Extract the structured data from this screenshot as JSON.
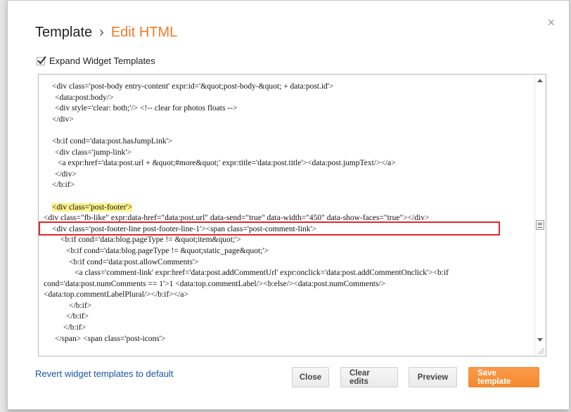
{
  "dialog": {
    "breadcrumb": {
      "parent": "Template",
      "separator": "›",
      "current": "Edit HTML"
    },
    "close_glyph": "×",
    "expand_widget_templates": {
      "label": "Expand Widget Templates",
      "checked": true
    },
    "code_lines": [
      "<div class='post-body entry-content' expr:id='&quot;post-body-&quot; + data:post.id'>",
      "  <data:post.body/>",
      "  <div style='clear: both;'/> <!-- clear for photos floats -->",
      "</div>",
      "",
      "<b:if cond='data:post.hasJumpLink'>",
      "  <div class='jump-link'>",
      "    <a expr:href='data:post.url + &quot;#more&quot;' expr:title='data:post.title'><data:post.jumpText/></a>",
      "  </div>",
      "</b:if>",
      "",
      "<div class='post-footer'>",
      "<div class=\"fb-like\" expr:data-href=\"data:post.url\" data-send=\"true\" data-width=\"450\" data-show-faces=\"true\"></div>",
      "  <div class='post-footer-line post-footer-line-1'><span class='post-comment-link'>",
      "    <b:if cond='data:blog.pageType != &quot;item&quot;'>",
      "      <b:if cond='data:blog.pageType != &quot;static_page&quot;'>",
      "        <b:if cond='data:post.allowComments'>",
      "          <a class='comment-link' expr:href='data:post.addCommentUrl' expr:onclick='data:post.addCommentOnclick'><b:if",
      "cond='data:post.numComments == 1'>1 <data:top.commentLabel/><b:else/><data:post.numComments/>",
      "<data:top.commentLabelPlural/></b:if></a>",
      "        </b:if>",
      "      </b:if>",
      "    </b:if>",
      "  </span> <span class='post-icons'>"
    ],
    "footer": {
      "revert_link": "Revert widget templates to default",
      "buttons": {
        "close": "Close",
        "clear_edits": "Clear edits",
        "preview": "Preview",
        "save_template": "Save template"
      }
    },
    "colors": {
      "accent_orange": "#f5892e",
      "highlight_marker": "#fbf28a",
      "annotation_red": "#e2262c",
      "link_blue": "#1b54a6"
    }
  }
}
